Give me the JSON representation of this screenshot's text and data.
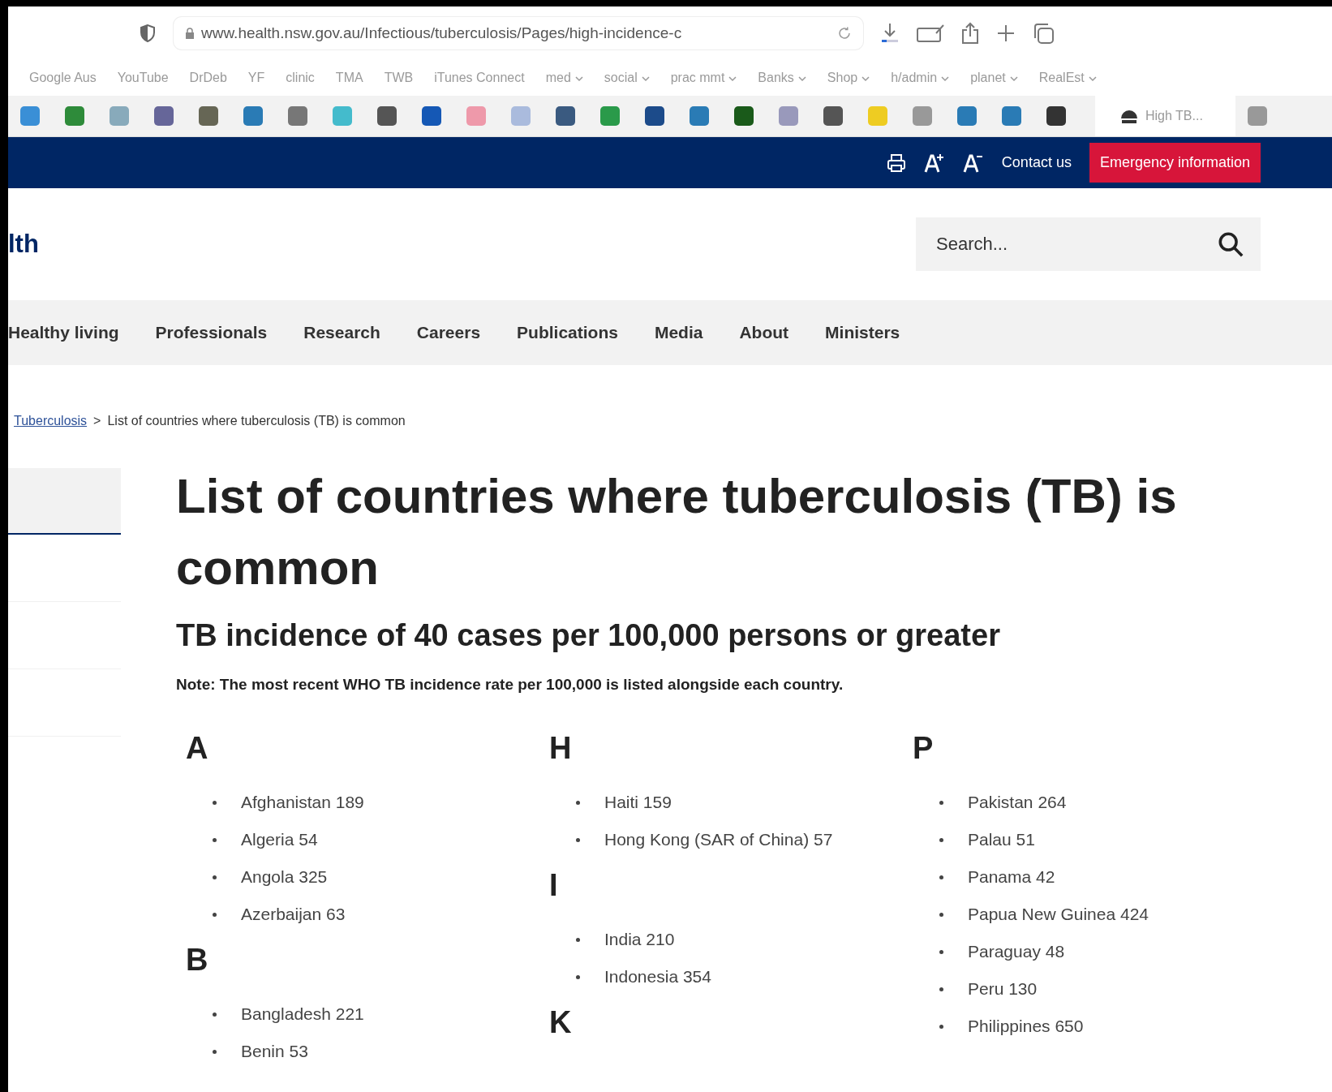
{
  "browser": {
    "url": "www.health.nsw.gov.au/Infectious/tuberculosis/Pages/high-incidence-c",
    "bookmarks": [
      {
        "label": "Google Aus",
        "menu": false
      },
      {
        "label": "YouTube",
        "menu": false
      },
      {
        "label": "DrDeb",
        "menu": false
      },
      {
        "label": "YF",
        "menu": false
      },
      {
        "label": "clinic",
        "menu": false
      },
      {
        "label": "TMA",
        "menu": false
      },
      {
        "label": "TWB",
        "menu": false
      },
      {
        "label": "iTunes Connect",
        "menu": false
      },
      {
        "label": "med",
        "menu": true
      },
      {
        "label": "social",
        "menu": true
      },
      {
        "label": "prac mmt",
        "menu": true
      },
      {
        "label": "Banks",
        "menu": true
      },
      {
        "label": "Shop",
        "menu": true
      },
      {
        "label": "h/admin",
        "menu": true
      },
      {
        "label": "planet",
        "menu": true
      },
      {
        "label": "RealEst",
        "menu": true
      }
    ],
    "tab": {
      "title": "High TB..."
    }
  },
  "utility_bar": {
    "contact": "Contact us",
    "emergency": "Emergency information"
  },
  "header": {
    "logo_text": "lth",
    "search": {
      "placeholder": "Search..."
    }
  },
  "nav": [
    "Healthy living",
    "Professionals",
    "Research",
    "Careers",
    "Publications",
    "Media",
    "About",
    "Ministers"
  ],
  "breadcrumb": {
    "link": "Tuberculosis",
    "separator": ">",
    "current": "List of countries where tuberculosis (TB) is common"
  },
  "title": "List of countries where tuberculosis (TB) is common",
  "subtitle": "TB incidence of 40 cases per 100,000 persons or greater",
  "note": "Note: The most recent WHO TB incidence rate per 100,000 is listed alongside each country.",
  "columns": [
    [
      {
        "letter": "A",
        "countries": [
          "Afghanistan 189",
          "Algeria 54",
          "Angola 325",
          "Azerbaijan 63"
        ]
      },
      {
        "letter": "B",
        "countries": [
          "Bangladesh 221",
          "Benin 53"
        ]
      }
    ],
    [
      {
        "letter": "H",
        "countries": [
          "Haiti 159",
          "Hong Kong (SAR of China) 57"
        ]
      },
      {
        "letter": "I",
        "countries": [
          "India 210",
          "Indonesia 354"
        ]
      },
      {
        "letter": "K"
      }
    ],
    [
      {
        "letter": "P",
        "countries": [
          "Pakistan 264",
          "Palau 51",
          "Panama 42",
          "Papua New Guinea 424",
          "Paraguay 48",
          "Peru 130",
          "Philippines 650"
        ]
      }
    ]
  ]
}
